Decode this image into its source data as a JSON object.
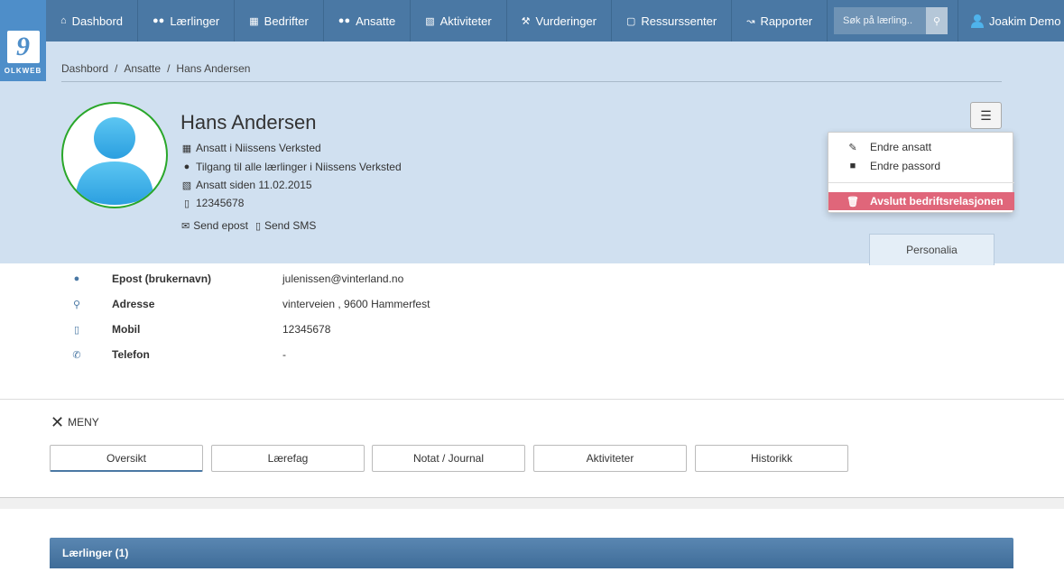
{
  "logo": {
    "text": "OLKWEB"
  },
  "nav": {
    "items": [
      {
        "label": "Dashbord",
        "icon": "home-icon"
      },
      {
        "label": "Lærlinger",
        "icon": "users-icon"
      },
      {
        "label": "Bedrifter",
        "icon": "building-icon"
      },
      {
        "label": "Ansatte",
        "icon": "users-icon"
      },
      {
        "label": "Aktiviteter",
        "icon": "calendar-icon"
      },
      {
        "label": "Vurderinger",
        "icon": "gavel-icon"
      },
      {
        "label": "Ressurssenter",
        "icon": "file-icon"
      },
      {
        "label": "Rapporter",
        "icon": "chart-icon"
      }
    ],
    "search_placeholder": "Søk på lærling..",
    "user_name": "Joakim Demo"
  },
  "breadcrumb": [
    "Dashbord",
    "Ansatte",
    "Hans Andersen"
  ],
  "profile": {
    "name": "Hans Andersen",
    "employer": "Ansatt i Niissens Verksted",
    "access": "Tilgang til alle lærlinger i Niissens Verksted",
    "since": "Ansatt siden 11.02.2015",
    "phone": "12345678",
    "send_email": "Send epost",
    "send_sms": "Send SMS"
  },
  "dropdown": {
    "edit": "Endre ansatt",
    "password": "Endre passord",
    "end_relation": "Avslutt bedriftsrelasjonen"
  },
  "tab_personalia": "Personalia",
  "info": [
    {
      "label": "Epost (brukernavn)",
      "value": "julenissen@vinterland.no",
      "icon": "user-icon"
    },
    {
      "label": "Adresse",
      "value": "vinterveien , 9600 Hammerfest",
      "icon": "map-marker-icon"
    },
    {
      "label": "Mobil",
      "value": "12345678",
      "icon": "mobile-icon"
    },
    {
      "label": "Telefon",
      "value": "-",
      "icon": "phone-icon"
    }
  ],
  "meny_label": "MENY",
  "tabs": [
    "Oversikt",
    "Lærefag",
    "Notat / Journal",
    "Aktiviteter",
    "Historikk"
  ],
  "panel_title": "Lærlinger (1)",
  "colors": {
    "nav": "#4a78a4",
    "header": "#d0e0f0",
    "danger": "#e0667a",
    "ring": "#2aa72a"
  }
}
